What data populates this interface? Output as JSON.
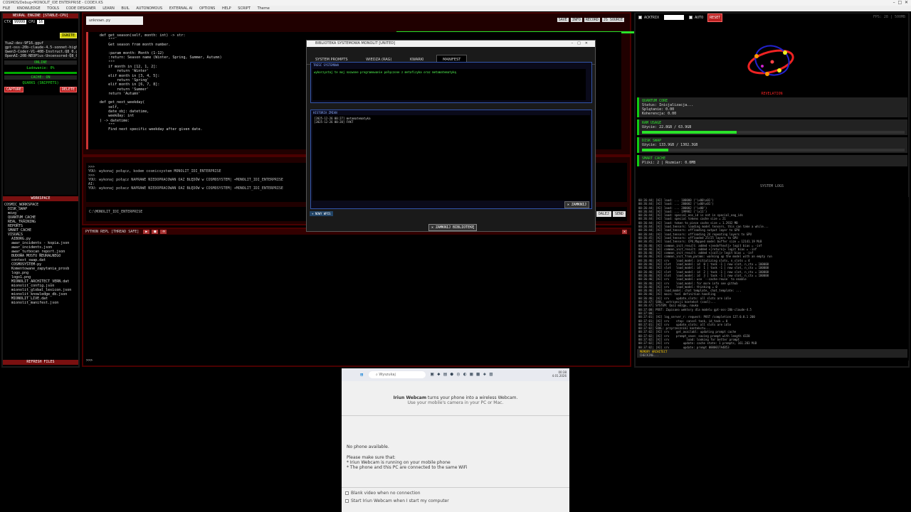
{
  "window": {
    "title": "COSMOS/Debug•MONOLIT_IDE ENTERPRISE - CODEX.KS"
  },
  "menu": [
    "FILE",
    "KNOWLEDGE",
    "TOOLS",
    "CODE DESIGNER",
    "LEARN",
    "BUIL",
    "AUTONOMOUS",
    "EXTERNAL AI",
    "OPTIONS",
    "HELP",
    "SCRIPT",
    "Theme"
  ],
  "left": {
    "engine_header": "NEURAL ENGINE [STABLE-CPU]",
    "ctx_label": "CTX",
    "ctx_value": "99999",
    "cpu_label": "CPU",
    "cpu_value": "16",
    "ignite": "IGNITE",
    "models": [
      "Yua2-dev-9F16.gguf",
      "gpt-oss-20b-claude-4.5-sonnet-high-rea",
      "Qwen3-Coder-V1-40B-Instruct.Q8_0.gguf",
      "OpenAI-20B-NEOPlus-Uncensored-Q8_0.g"
    ],
    "online": "ONLINE",
    "loading": "Ładowanie: 0%",
    "cache": "CACHE: ON",
    "quarks": "QUARKS (SNIPPETS)",
    "capture": "CAPTURE",
    "delete": "DELETE",
    "workspace": "WORKSPACE",
    "tree": [
      "COSMIC_WORKSPACE",
      "DISK_SWAP",
      "mózg",
      "QUANTUM_CACHE",
      "REAL_TRAINING",
      "REPORTS",
      "SMART_CACHE",
      "VISUALS",
      "AIBORG.py",
      "awar_incidents - kopia.json",
      "awar_incidents.json",
      "awar_turbocan_report.json",
      "BUDOWA MOSTU NEURALNEGO",
      "context_swap.dat",
      "COSMOSYSTEM-py",
      "Komentowane_zapytania_prosb",
      "logo.png",
      "logo1.png",
      "MIONOLIT_ARCHITECT_VERN.dat",
      "mionolit_config.json",
      "mionolit_global_lexicon.json",
      "mionolit_knowledge_db.json",
      "MIONOLIT_LIVE.dat",
      "mionolit_manifest.json"
    ],
    "refresh": "REFRESH FILES"
  },
  "editor": {
    "tab": "unknown.py",
    "buttons": [
      "SAVE",
      "INFO",
      "RECORD",
      "JS SOURCE"
    ],
    "code": "    def get_season(self, month: int) -> str:\n        \"\"\"\n        Get season from month number.\n\n        :param month: Month (1-12)\n        :return: Season name (Winter, Spring, Summer, Autumn)\n        \"\"\"\n        if month in [12, 1, 2]:\n            return 'Winter'\n        elif month in [3, 4, 5]:\n            return 'Spring'\n        elif month in [6, 7, 8]:\n            return 'Summer'\n        return 'Autumn'\n\n    def get_next_weekday(\n        self,\n        date_obj: datetime,\n        weekday: int\n    ) -> datetime:\n        \"\"\"\n        Find next specific weekday after given date.",
    "chat": ">>>\nYOU: wykonaj połącz, kodem cosmicsystem MONOLIT_IDI_ENTERPRISE\n>>>\nYOU: wykonaj połącz NAPRAWE NIEDOPRACOWAN OAZ BŁĘDÓW w COSMOSYSTEM| +MONOLIT_IDI_ENTERPRISE\nAI:\nYOU: wykonaj połacz NAPRAWE NIEDOPRACOWAN OAZ BŁĘDÓW w COSMOSYSTEM| +MONOLIT_IDI_ENTERPRISE",
    "cmd": "C:\\MONOLIT_IDI_ENTERPRISE",
    "send": [
      "DALEJ",
      "SEND"
    ]
  },
  "terminal": {
    "title": "PYTHON REPL [THREAD SAFE]",
    "prompt": ">>>"
  },
  "right": {
    "acktrix": "ACKTRIX",
    "auto": "AUTO",
    "reset": "RESET",
    "fps": "FPS: 28  |  500MB",
    "revelation": "REVELATION",
    "quantum_title": "QUANTUM CORE",
    "quantum_lines": [
      "Status: Inicjalizacja...",
      "Splątanie: 0.00",
      "Koherencja: 0.00"
    ],
    "ram_title": "RAM USAGE",
    "ram_value": "Użycie: 22.8GB / 63.9GB",
    "ram_pct": 0.36,
    "swap_title": "DISK SWAP",
    "swap_value": "Użycie: 133.9GB / 1302.3GB",
    "swap_pct": 0.1,
    "smart_title": "SMART CACHE",
    "smart_value": "Pliki: 2 | Rozmiar: 0.0MB",
    "logs_title": "SYSTEM LOGS",
    "logs": "00:36:44| [AI] load: ... 100000 ('\\x00\\x01')\n00:36:44| [AI] load: ... 200002 ('\\x00\\x01')\n00:36:44| [AI] load: ... 200002 ('\\x00')\n00:36:44| [AI] load: ... 199982 ('\\x11')\n00:36:44| [AI] load: special_eos_id is not in special_eog_ids\n00:36:44| [AI] load: special tokens cache size = 21\n00:36:44| [AI] load: token to piece cache size = 1.2932 MB\n00:36:44| [AI] load_tensors: loading model tensors, this can take a while...\n00:36:44| [AI] load_tensors: offloading output layer to GPU\n00:36:44| [AI] load_tensors: offloading 24 repeating layers to GPU\n00:36:45| [AI] load_tensors: offloaded 25/25 layers to GPU\n00:36:45| [AI] load_tensors: CPU_Mapped model buffer size = 12141.19 MiB\n00:36:46| [AI] common_init_result: added <|endoftext|> logit bias = -inf\n00:36:46| [AI] common_init_result: added <|return|> logit bias = -inf\n00:36:46| [AI] common_init_result: added <|call|> logit bias = -inf\n00:36:46| [AI] common_init_from_params: warming up the model with an empty run\n00:36:46| [AI] srv    load_model: initializing slots, n_slots = 4\n00:36:46| [AI] slot   load_model: id  0 | task -1 | new slot, n_ctx = 100000\n00:36:46| [AI] slot   load_model: id  1 | task -1 | new slot, n_ctx = 100000\n00:36:46| [AI] slot   load_model: id  2 | task -1 | new slot, n_ctx = 100000\n00:36:46| [AI] slot   load_model: id  3 | task -1 | new slot, n_ctx = 100000\n00:36:46| [AI] srv    load_model: use `--cache-reuse` to enable\n00:36:46| [AI] srv    load_model: for more info see github\n00:36:46| [AI] srv    load_model: thinking = 0\n00:36:46| [AI] load_model: chat template, chat_template: ...\n00:36:46| [AI] main: tool definition handling\n00:36:46| [AI] srv    update_slots: all slots are idle\n00:36:47| SOUL: ustrzyncji kontekst (cool)...\n00:36:47| SYSTEM: Quiz mózgu, nauka\n00:37:00| POST: Zapisano wektory dla modelu gpt-oss-20b-claude-4.5\n00:37:00| ---\n00:37:01| [AI] log_server_r: request: POST /completion 127.0.0.1 200\n00:37:01| [AI] srv    stop: cancel task, id_task = 0\n00:37:01| [AI] srv    update_slots: all slots are idle\n00:37:02| SOUL: przyrzeczniki kontekstu...\n00:37:02| [AI] srv    get_availabl: updating prompt cache\n00:37:02| [AI] srv    prompt_save: saving prompt with length 4320\n00:37:02| [AI] srv          load: looking for better prompt\n00:37:02| [AI] srv        update: cache state: 1 prompts, 161.283 MiB\n00:37:02| [AI] srv        update: prompt 0000017A4B53\n00:37:02| [AI] srv    get_availabl: prompt cache update took 14.80 ms",
    "memory": "MEMORY ARCHITECT",
    "memory_status": "CHECKING..."
  },
  "dialog": {
    "title": "BIBLIOTEKA SYSTEMOWA MONOLIT [UNITED]",
    "tabs": [
      "SYSTEM PROMPTS",
      "WIEDZA (RAG)",
      "KWARKI",
      "MANIFEST"
    ],
    "content_label": "TREŚĆ SYSTEMOWA",
    "content": "wykorzystaj te moj nazwane programowanie połączone z metafizyka oraz metamatematyką",
    "history_label": "HISTORIA ZMIAN",
    "history": [
      "[2025-12-26 00:27] metamatematyka",
      "[2025-12-26 00:20] FAKT"
    ],
    "close": "ZAMKNIJ",
    "new": "NOWY WPIS",
    "close_lib": "ZAMKNIJ BIBLIOTEKĘ"
  },
  "taskbar": {
    "search": "Wyszukaj",
    "time": "00:38",
    "date": "4.01.2026"
  },
  "iriun": {
    "headline_bold": "Iriun Webcam",
    "headline": "turns your phone into a wireless Webcam.",
    "sub": "Use your mobile's camera in your PC or Mac.",
    "no_phone": "No phone available.",
    "make_sure": "Please make sure that:",
    "b1": "* Iriun Webcam is running on your mobile phone",
    "b2": "* The phone and this PC are connected to the same WiFi",
    "opt1": "Blank video when no connection",
    "opt2": "Start Iriun Webcam when I start my computer"
  }
}
